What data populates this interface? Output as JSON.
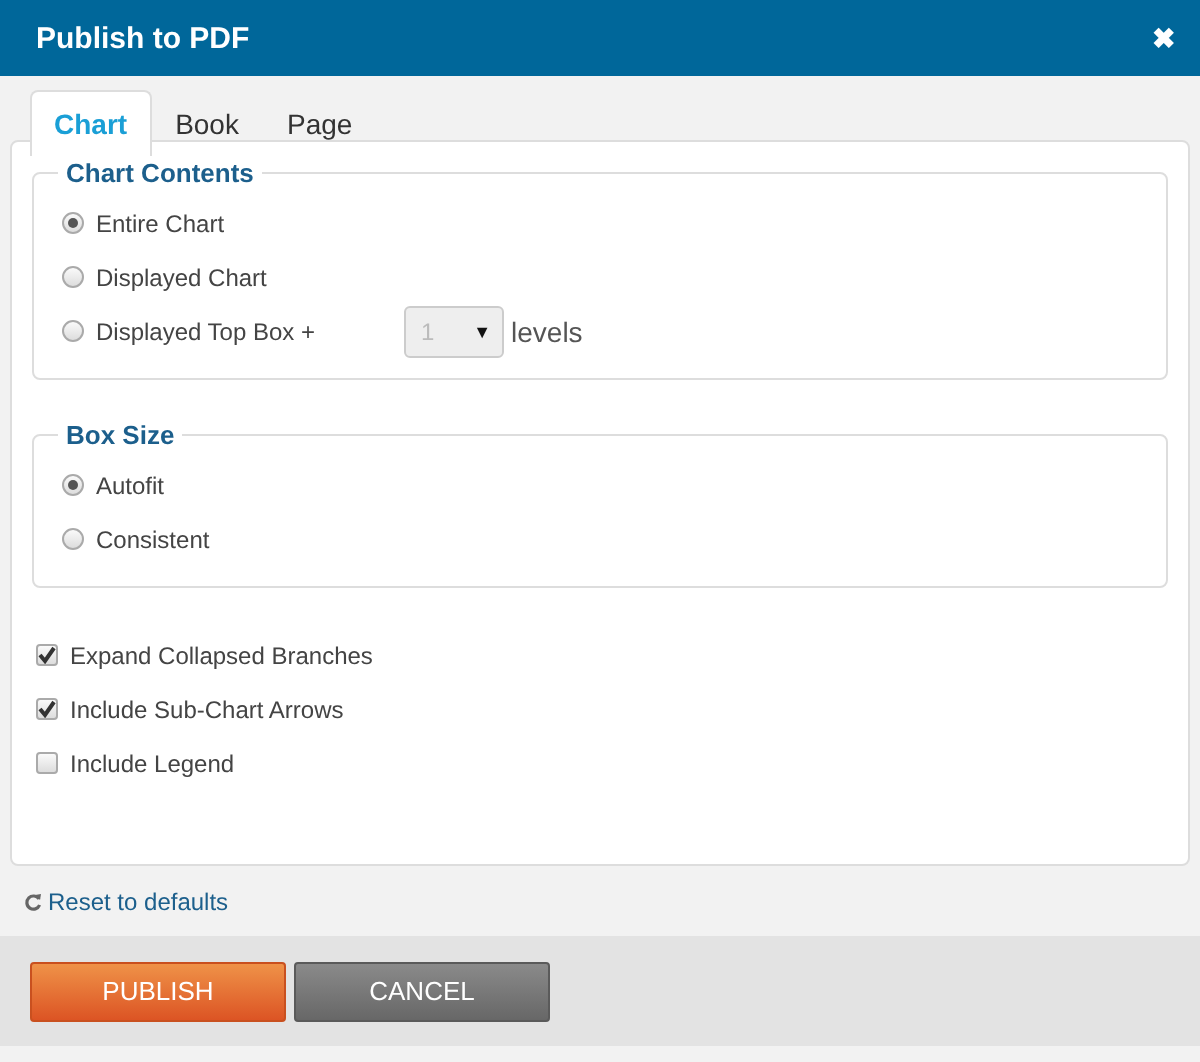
{
  "window": {
    "title": "Publish to PDF",
    "close": "✖"
  },
  "tabs": [
    {
      "label": "Chart",
      "selected": true
    },
    {
      "label": "Book",
      "selected": false
    },
    {
      "label": "Page",
      "selected": false
    }
  ],
  "groups": [
    {
      "title": "Chart Contents",
      "options": [
        {
          "label": "Entire Chart",
          "selected": true
        },
        {
          "label": "Displayed Chart",
          "selected": false
        },
        {
          "label": "Displayed Top Box +",
          "selected": false,
          "dropdown": {
            "value": "1",
            "caret": "▼",
            "disabled": true
          },
          "suffix": "levels"
        }
      ]
    },
    {
      "title": "Box Size",
      "options": [
        {
          "label": "Autofit",
          "selected": true
        },
        {
          "label": "Consistent",
          "selected": false
        }
      ]
    }
  ],
  "checkboxes": [
    {
      "label": "Expand Collapsed Branches",
      "checked": true
    },
    {
      "label": "Include Sub-Chart Arrows",
      "checked": true
    },
    {
      "label": "Include Legend",
      "checked": false
    }
  ],
  "reset_link": "Reset to defaults",
  "buttons": [
    {
      "label": "PUBLISH",
      "kind": "primary"
    },
    {
      "label": "CANCEL",
      "kind": "secondary"
    }
  ]
}
